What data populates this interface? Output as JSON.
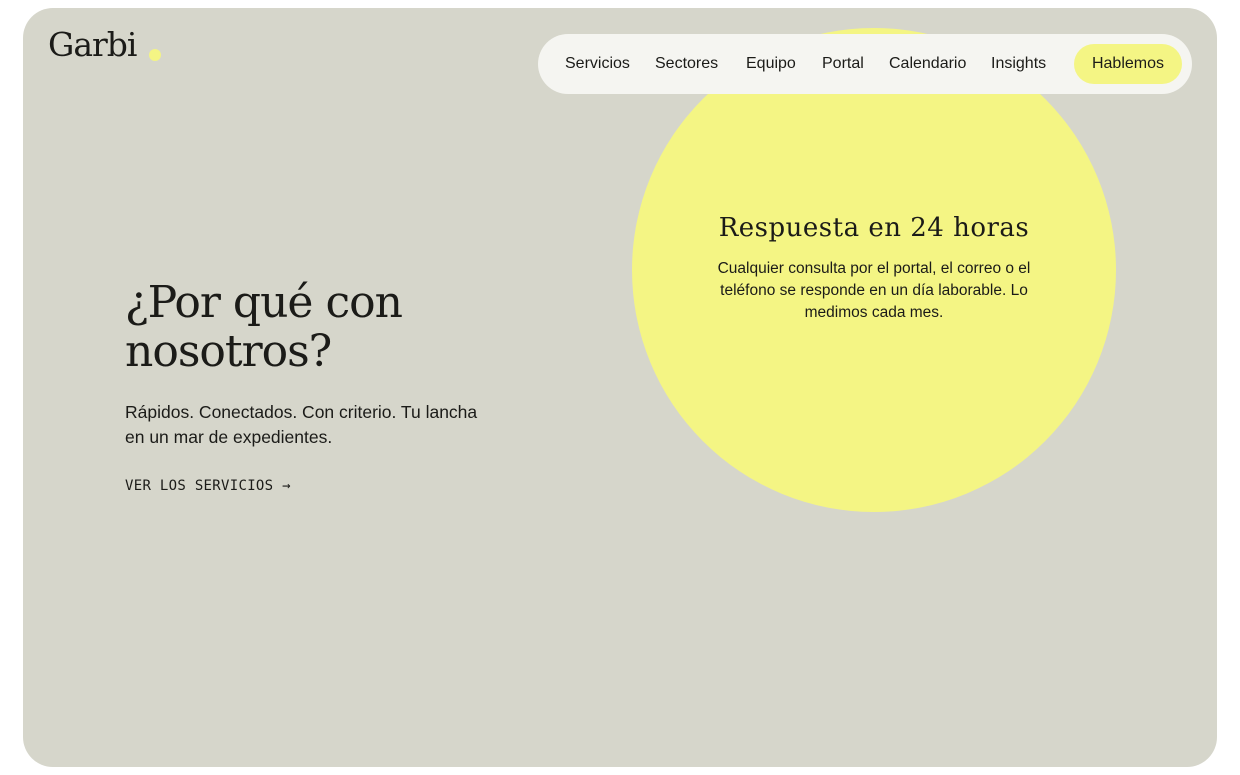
{
  "logo": {
    "text": "Garbi"
  },
  "nav": {
    "items": [
      {
        "label": "Servicios"
      },
      {
        "label": "Sectores"
      },
      {
        "label": "Equipo"
      },
      {
        "label": "Portal"
      },
      {
        "label": "Calendario"
      },
      {
        "label": "Insights"
      }
    ],
    "cta_label": "Hablemos"
  },
  "hero": {
    "title": "¿Por qué con nosotros?",
    "subtitle": "Rápidos. Conectados. Con criterio. Tu lancha en un mar de expedientes.",
    "link_label": "VER LOS SERVICIOS →"
  },
  "feature": {
    "title": "Respuesta en 24 horas",
    "text": "Cualquier consulta por el portal, el correo o el teléfono se responde en un día laborable. Lo medimos cada mes."
  },
  "colors": {
    "background": "#d6d6cb",
    "accent": "#f4f584",
    "nav_background": "#f5f5f1",
    "text": "#1b1b18"
  }
}
